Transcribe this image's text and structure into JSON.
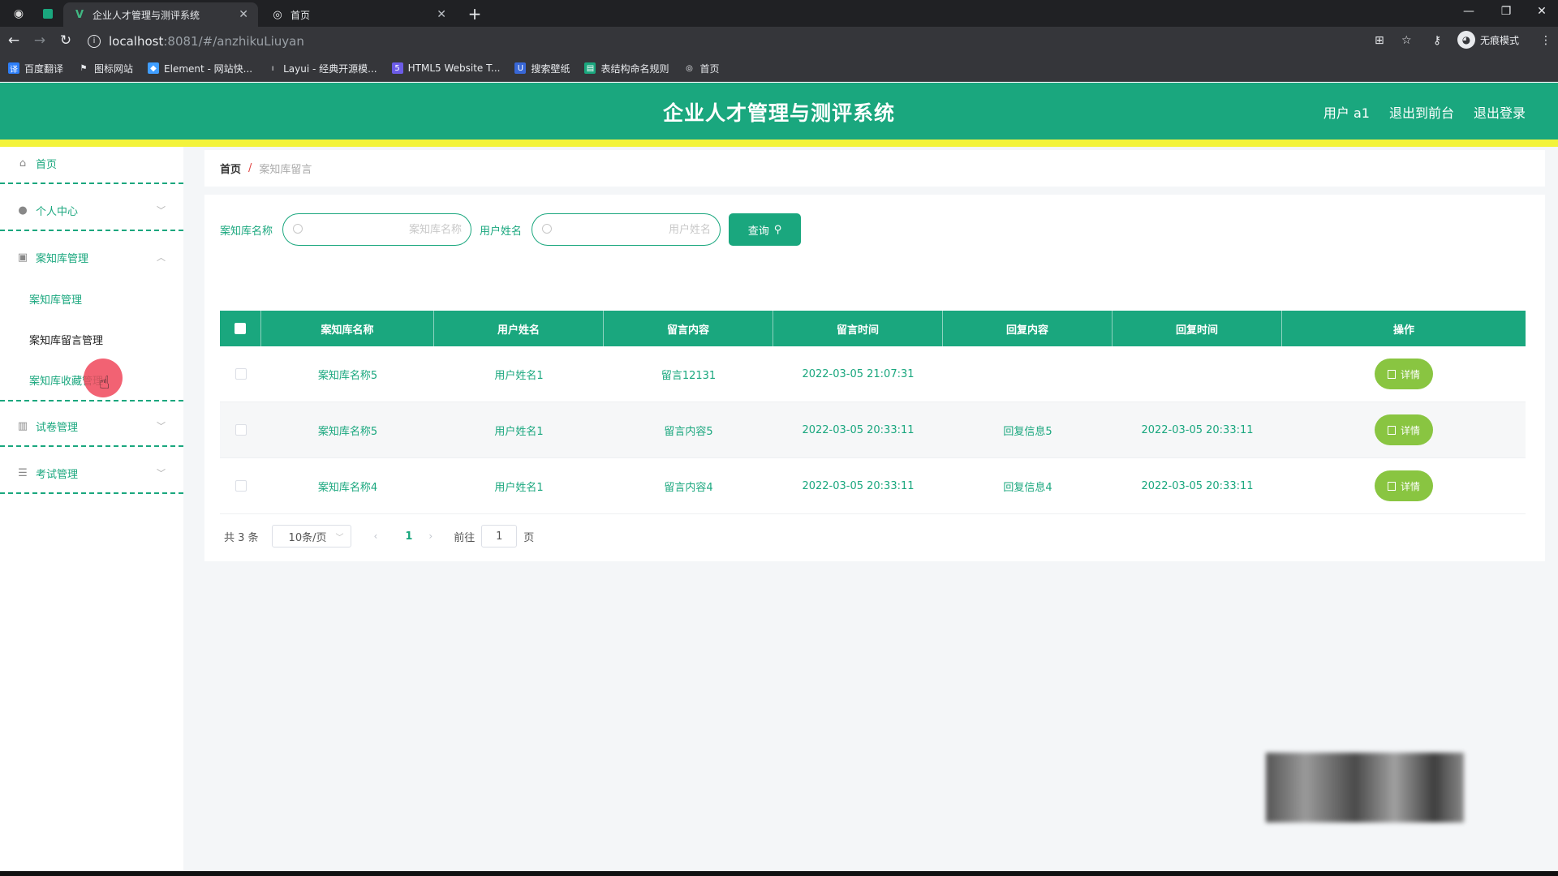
{
  "browser": {
    "tabs": [
      {
        "title": "企业人才管理与测评系统",
        "active": true
      },
      {
        "title": "首页",
        "active": false
      }
    ],
    "url_host": "localhost",
    "url_path": ":8081/#/anzhikuLiuyan",
    "profile_label": "无痕模式",
    "bookmarks": [
      "百度翻译",
      "图标网站",
      "Element - 网站快...",
      "Layui - 经典开源模...",
      "HTML5 Website T...",
      "搜索壁纸",
      "表结构命名规则",
      "首页"
    ]
  },
  "header": {
    "title": "企业人才管理与测评系统",
    "links": [
      "用户 a1",
      "退出到前台",
      "退出登录"
    ],
    "colors": {
      "primary": "#1aa77e",
      "accent_bar": "#f3f33b",
      "detail_button": "#89c541"
    }
  },
  "sidebar": {
    "home": "首页",
    "personal_center": "个人中心",
    "kb_manage": "案知库管理",
    "kb_sub": [
      "案知库管理",
      "案知库留言管理",
      "案知库收藏管理"
    ],
    "exam_paper": "试卷管理",
    "exam": "考试管理"
  },
  "breadcrumb": {
    "home": "首页",
    "separator": "/",
    "current": "案知库留言"
  },
  "search": {
    "field1_label": "案知库名称",
    "field1_placeholder": "案知库名称",
    "field2_label": "用户姓名",
    "field2_placeholder": "用户姓名",
    "button": "查询"
  },
  "table": {
    "headers": [
      "案知库名称",
      "用户姓名",
      "留言内容",
      "留言时间",
      "回复内容",
      "回复时间",
      "操作"
    ],
    "rows": [
      {
        "name": "案知库名称5",
        "user": "用户姓名1",
        "content": "留言12131",
        "time": "2022-03-05 21:07:31",
        "reply": "",
        "reply_time": "",
        "action": "详情"
      },
      {
        "name": "案知库名称5",
        "user": "用户姓名1",
        "content": "留言内容5",
        "time": "2022-03-05 20:33:11",
        "reply": "回复信息5",
        "reply_time": "2022-03-05 20:33:11",
        "action": "详情"
      },
      {
        "name": "案知库名称4",
        "user": "用户姓名1",
        "content": "留言内容4",
        "time": "2022-03-05 20:33:11",
        "reply": "回复信息4",
        "reply_time": "2022-03-05 20:33:11",
        "action": "详情"
      }
    ]
  },
  "pagination": {
    "total": "共 3 条",
    "page_size": "10条/页",
    "current_page": "1",
    "goto_label": "前往",
    "goto_value": "1",
    "page_suffix": "页"
  }
}
